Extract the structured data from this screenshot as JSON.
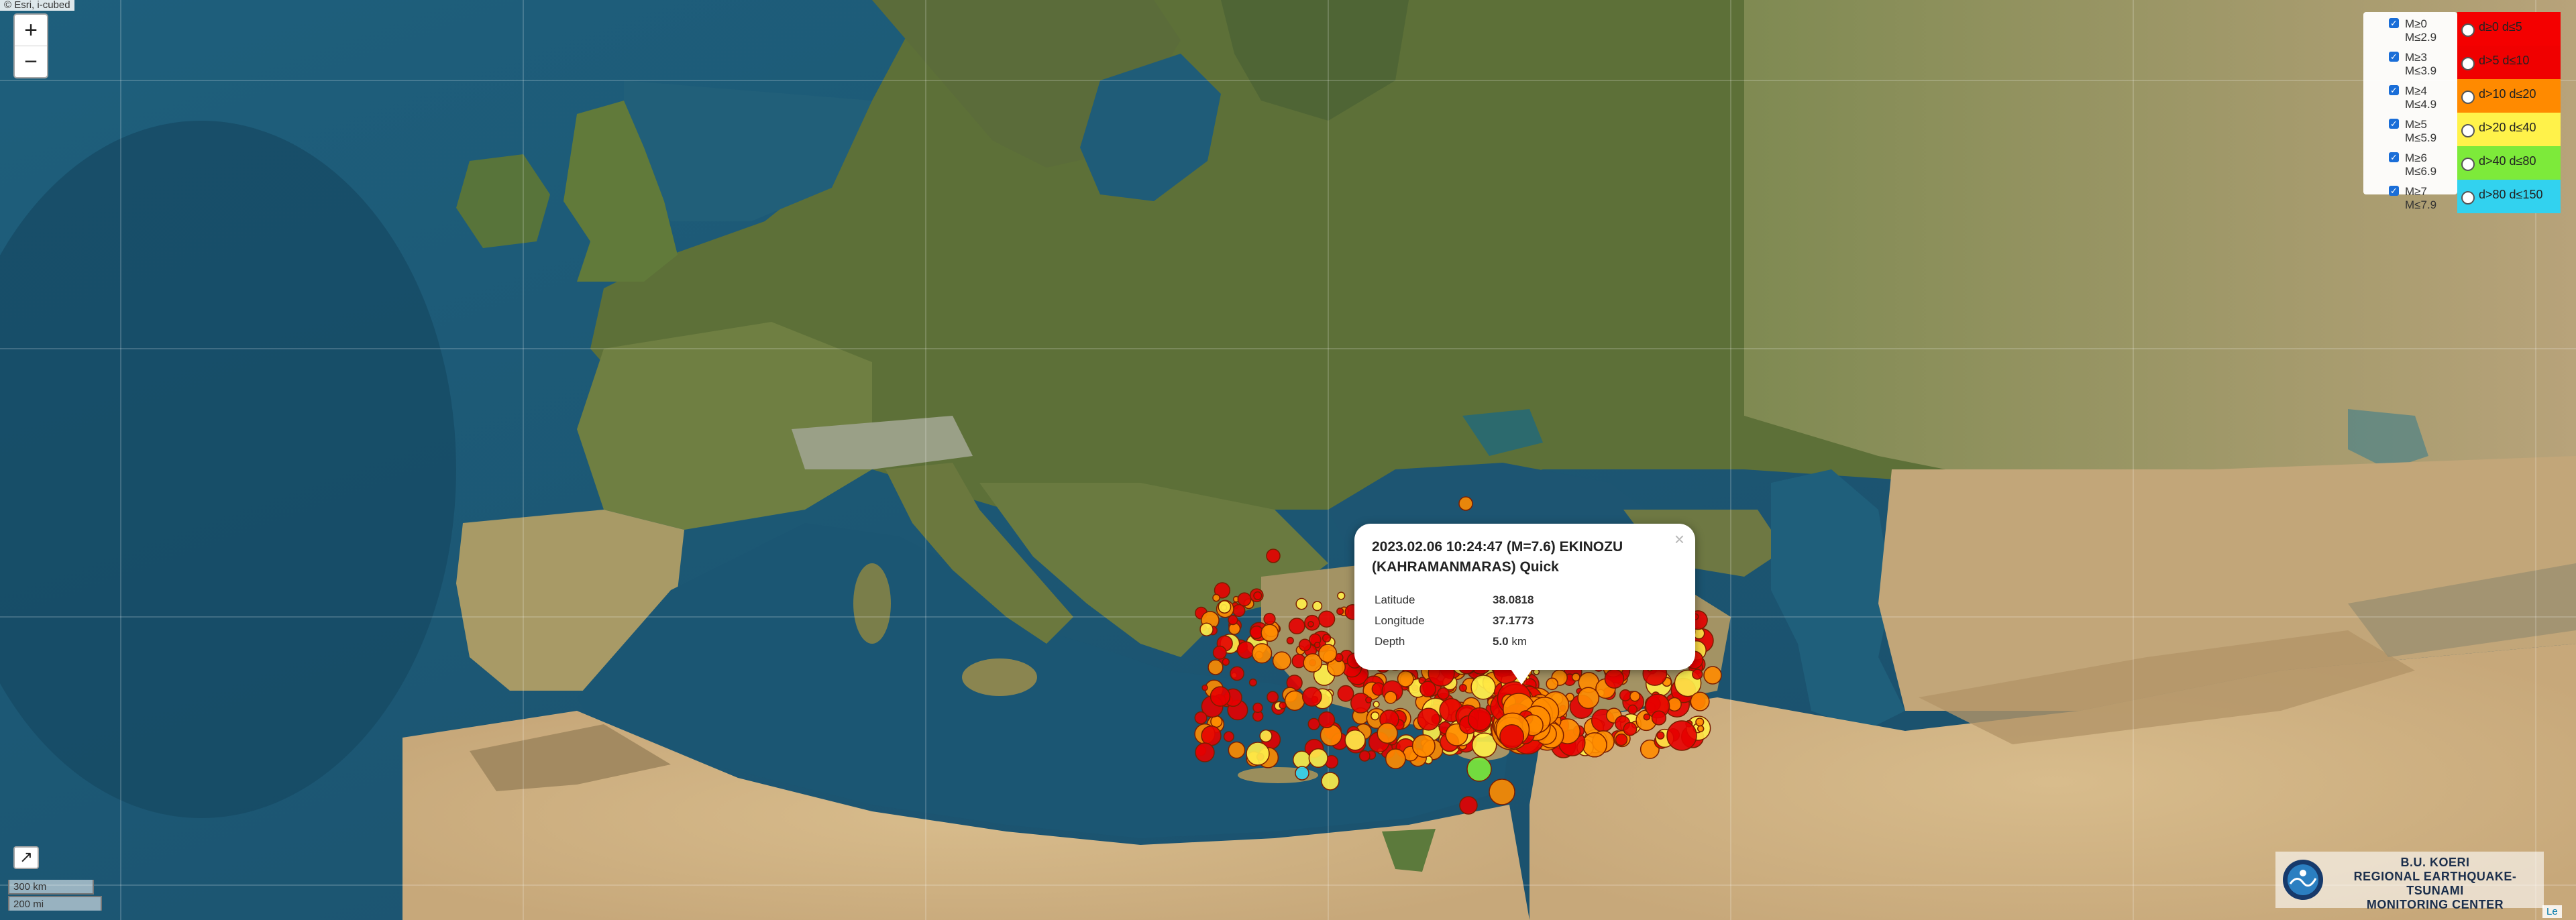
{
  "attribution": {
    "prefix": "©",
    "source": "Esri, i-cubed, USDA, USGS, AEX, GeoEye, Getmapping, Aerogrid, IGN, IGP, UPR-EGP, and the GIS User Community",
    "visible_start": "© Esri, i-cubed",
    "link": "Leaflet",
    "link_visible": "Le"
  },
  "zoom": {
    "in_label": "+",
    "out_label": "−"
  },
  "fullscreen": {
    "icon": "expand-arrow-icon",
    "glyph": "↗"
  },
  "scale": {
    "km": "300 km",
    "mi": "200 mi"
  },
  "magnitude_legend": [
    {
      "label": "M≥0\nM≤2.9",
      "checked": true
    },
    {
      "label": "M≥3\nM≤3.9",
      "checked": true
    },
    {
      "label": "M≥4\nM≤4.9",
      "checked": true
    },
    {
      "label": "M≥5\nM≤5.9",
      "checked": true
    },
    {
      "label": "M≥6\nM≤6.9",
      "checked": true
    },
    {
      "label": "M≥7\nM≤7.9",
      "checked": true
    }
  ],
  "depth_legend": [
    {
      "label": "d≥0  d≤5",
      "color": "#f40000"
    },
    {
      "label": "d>5  d≤10",
      "color": "#f00000"
    },
    {
      "label": "d>10  d≤20",
      "color": "#ff8a00"
    },
    {
      "label": "d>20  d≤40",
      "color": "#fff24a"
    },
    {
      "label": "d>40  d≤80",
      "color": "#7dea3a"
    },
    {
      "label": "d>80  d≤150",
      "color": "#32d2ef"
    }
  ],
  "popup": {
    "close": "×",
    "title": "2023.02.06 10:24:47 (M=7.6) EKINOZU (KAHRAMANMARAS) Quick",
    "rows": [
      {
        "key": "Latitude",
        "value": "38.0818",
        "unit": ""
      },
      {
        "key": "Longitude",
        "value": "37.1773",
        "unit": ""
      },
      {
        "key": "Depth",
        "value": "5.0",
        "unit": " km"
      }
    ]
  },
  "logo": {
    "line1": "B.U. KOERI",
    "line2": "REGIONAL EARTHQUAKE-TSUNAMI",
    "line3": "MONITORING CENTER",
    "emblem_icon": "koeri-emblem-icon"
  },
  "colors": {
    "sea": "#1d5774",
    "deep_sea": "#15405a",
    "land_green": "#5f7437",
    "land_desert": "#cfb183",
    "quake_red": "#e60000",
    "quake_orange": "#ff8c00",
    "quake_yellow": "#fff04a",
    "quake_green": "#7dea3a",
    "quake_cyan": "#32d2ef",
    "popup_title": "#222222"
  }
}
